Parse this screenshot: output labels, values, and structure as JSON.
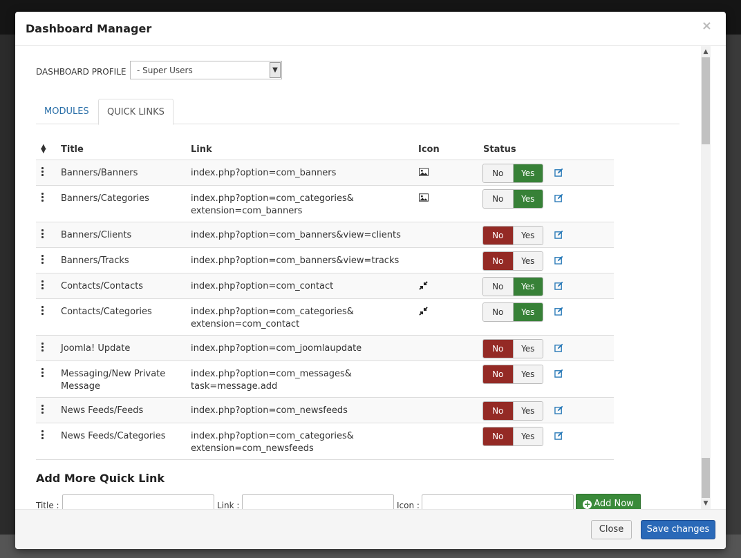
{
  "modal": {
    "title": "Dashboard Manager",
    "close_glyph": "×"
  },
  "profile": {
    "label": "DASHBOARD PROFILE",
    "selected": "- Super Users"
  },
  "tabs": [
    {
      "label": "MODULES",
      "active": false
    },
    {
      "label": "QUICK LINKS",
      "active": true
    }
  ],
  "table": {
    "headers": {
      "title": "Title",
      "link": "Link",
      "icon": "Icon",
      "status": "Status"
    },
    "toggle_labels": {
      "no": "No",
      "yes": "Yes"
    },
    "rows": [
      {
        "title": "Banners/Banners",
        "link": "index.php?option=com_banners",
        "icon": "image-icon",
        "status": "yes"
      },
      {
        "title": "Banners/Categories",
        "link": "index.php?option=com_categories&\nextension=com_banners",
        "icon": "image-icon",
        "status": "yes"
      },
      {
        "title": "Banners/Clients",
        "link": "index.php?option=com_banners&view=clients",
        "icon": "",
        "status": "no"
      },
      {
        "title": "Banners/Tracks",
        "link": "index.php?option=com_banners&view=tracks",
        "icon": "",
        "status": "no"
      },
      {
        "title": "Contacts/Contacts",
        "link": "index.php?option=com_contact",
        "icon": "compress-icon",
        "status": "yes"
      },
      {
        "title": "Contacts/Categories",
        "link": "index.php?option=com_categories&\nextension=com_contact",
        "icon": "compress-icon",
        "status": "yes"
      },
      {
        "title": "Joomla! Update",
        "link": "index.php?option=com_joomlaupdate",
        "icon": "",
        "status": "no"
      },
      {
        "title": "Messaging/New Private\nMessage",
        "link": "index.php?option=com_messages&\ntask=message.add",
        "icon": "",
        "status": "no"
      },
      {
        "title": "News Feeds/Feeds",
        "link": "index.php?option=com_newsfeeds",
        "icon": "",
        "status": "no"
      },
      {
        "title": "News Feeds/Categories",
        "link": "index.php?option=com_categories&\nextension=com_newsfeeds",
        "icon": "",
        "status": "no"
      }
    ]
  },
  "add_more": {
    "heading": "Add More Quick Link",
    "title_label": "Title :",
    "link_label": "Link :",
    "icon_label": "Icon :",
    "button_label": "Add Now"
  },
  "footer": {
    "close_label": "Close",
    "save_label": "Save changes"
  },
  "colors": {
    "no_active": "#942a25",
    "yes_active": "#378137",
    "edit_icon": "#2a7ab8",
    "primary": "#2a69b8"
  }
}
